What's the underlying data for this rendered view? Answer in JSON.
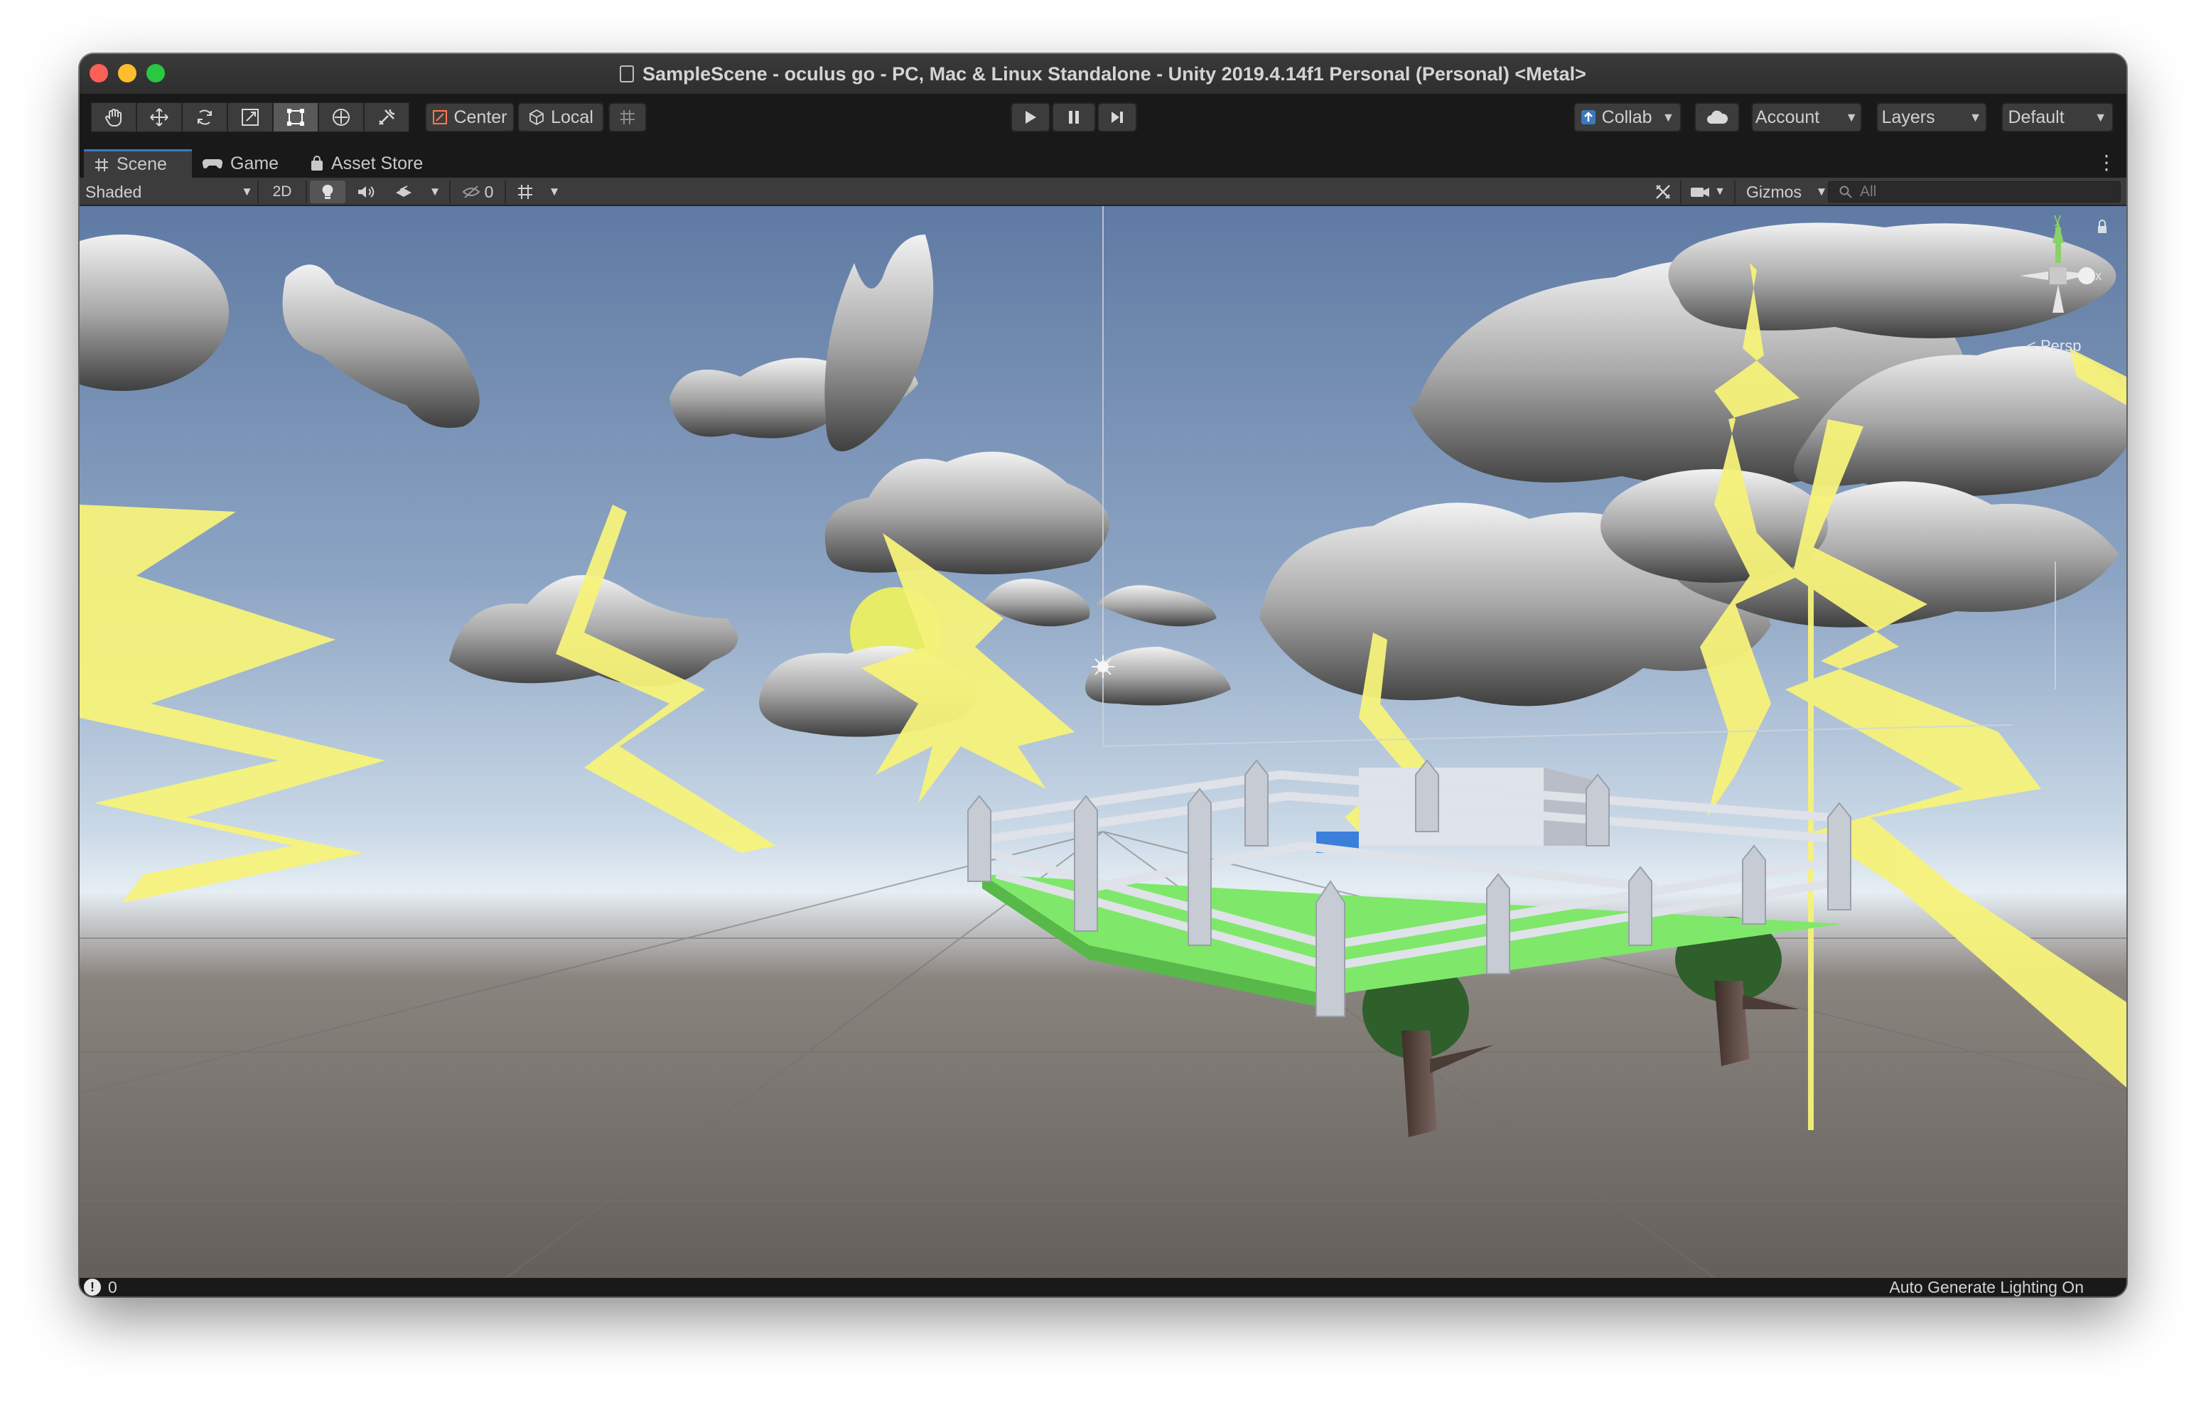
{
  "window": {
    "title": "SampleScene - oculus go - PC, Mac & Linux Standalone - Unity 2019.4.14f1 Personal (Personal) <Metal>"
  },
  "toolbar": {
    "pivot_label": "Center",
    "space_label": "Local",
    "collab_label": "Collab",
    "account_label": "Account",
    "layers_label": "Layers",
    "layout_label": "Default"
  },
  "tabs": [
    {
      "label": "Scene",
      "active": true
    },
    {
      "label": "Game",
      "active": false
    },
    {
      "label": "Asset Store",
      "active": false
    }
  ],
  "scene_bar": {
    "draw_mode": "Shaded",
    "mode_2d": "2D",
    "hidden_count": "0",
    "gizmos_label": "Gizmos",
    "search_placeholder": "All"
  },
  "gizmo": {
    "axis_y": "y",
    "axis_x": "x",
    "projection_label": "< Persp"
  },
  "status": {
    "count": "0",
    "lighting": "Auto Generate Lighting On"
  },
  "colors": {
    "sky_top": "#5f7aa3",
    "sky_horizon": "#e6eef4",
    "ground": "#6b6460",
    "lightning": "#f6f27a",
    "grass": "#7fe86a",
    "accent_tab": "#3a79bb"
  }
}
